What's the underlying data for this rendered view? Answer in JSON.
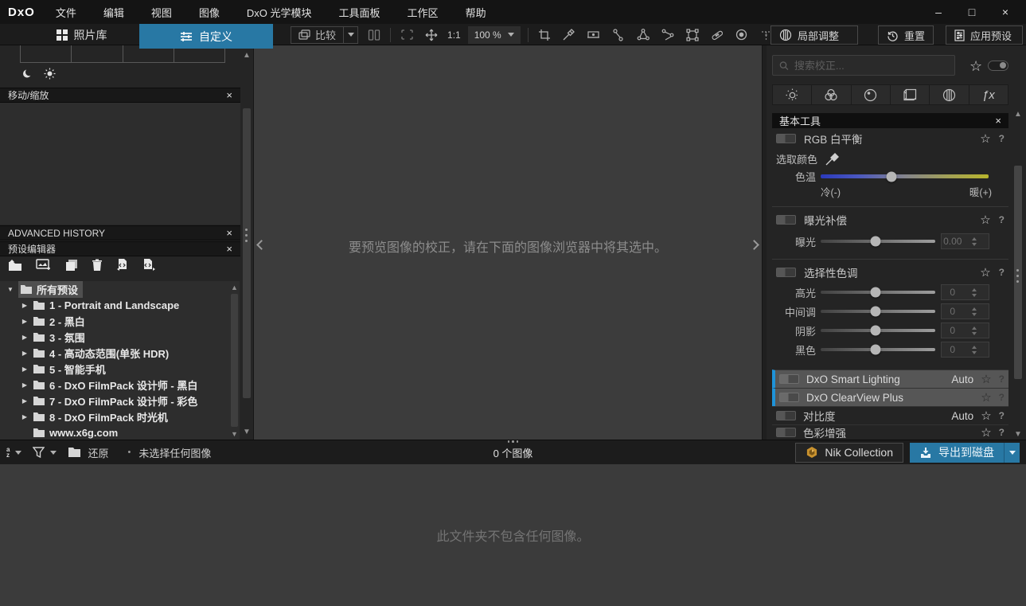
{
  "titlebar": {
    "logo": "DxO",
    "menus": [
      "文件",
      "编辑",
      "视图",
      "图像",
      "DxO 光学模块",
      "工具面板",
      "工作区",
      "帮助"
    ],
    "window_controls": {
      "minimize": "–",
      "maximize": "□",
      "close": "×"
    }
  },
  "toolbar": {
    "photo_library_tab": "照片库",
    "customize_tab": "自定义",
    "compare_label": "比较",
    "ratio_label": "1:1",
    "zoom_value": "100 %",
    "local_adjust_label": "局部调整",
    "reset_label": "重置",
    "apply_preset_label": "应用预设"
  },
  "left_panel": {
    "move_zoom_title": "移动/缩放",
    "advanced_history_title": "ADVANCED HISTORY",
    "preset_editor_title": "预设编辑器",
    "tree_root": "所有预设",
    "tree_items": [
      "1 - Portrait and Landscape",
      "2 - 黑白",
      "3 - 氛围",
      "4 - 高动态范围(单张 HDR)",
      "5 - 智能手机",
      "6 - DxO FilmPack 设计师 - 黑白",
      "7 - DxO FilmPack 设计师 - 彩色",
      "8 - DxO FilmPack 时光机",
      "www.x6g.com"
    ]
  },
  "viewer": {
    "message": "要预览图像的校正，请在下面的图像浏览器中将其选中。"
  },
  "right_panel": {
    "search_placeholder": "搜索校正...",
    "fx_tab_label": "ƒx",
    "basic_tools_title": "基本工具",
    "wb": {
      "title": "RGB 白平衡",
      "pick_color_label": "选取颜色",
      "temp_label": "色温",
      "cold_label": "冷(-)",
      "warm_label": "暖(+)"
    },
    "exposure": {
      "title": "曝光补偿",
      "slider_label": "曝光",
      "value": "0.00"
    },
    "selective_tone": {
      "title": "选择性色调",
      "sliders": [
        {
          "label": "高光",
          "value": "0"
        },
        {
          "label": "中间调",
          "value": "0"
        },
        {
          "label": "阴影",
          "value": "0"
        },
        {
          "label": "黑色",
          "value": "0"
        }
      ]
    },
    "collapsed_tools": [
      {
        "title": "DxO Smart Lighting",
        "badge": "Auto"
      },
      {
        "title": "DxO ClearView Plus",
        "badge": ""
      },
      {
        "title": "对比度",
        "badge": "Auto"
      },
      {
        "title": "色彩增强",
        "badge": ""
      }
    ]
  },
  "bottom_bar": {
    "sort_a": "a",
    "sort_z": "z",
    "restore_label": "还原",
    "separator": "•",
    "selection_status": "未选择任何图像",
    "image_count": "0 个图像",
    "nik_label": "Nik Collection",
    "export_label": "导出到磁盘"
  },
  "browser": {
    "empty_message": "此文件夹不包含任何图像。"
  },
  "ui": {
    "close_glyph": "×",
    "star_glyph": "☆",
    "help_glyph": "?",
    "expanded_arrow": "▼",
    "collapsed_arrow": "▶"
  },
  "colors": {
    "accent_blue": "#2878a4",
    "highlight_blue": "#1f93d8",
    "temp_cold": "#2b3abc",
    "temp_warm": "#b7b42c",
    "nik_gold": "#c9922e"
  }
}
